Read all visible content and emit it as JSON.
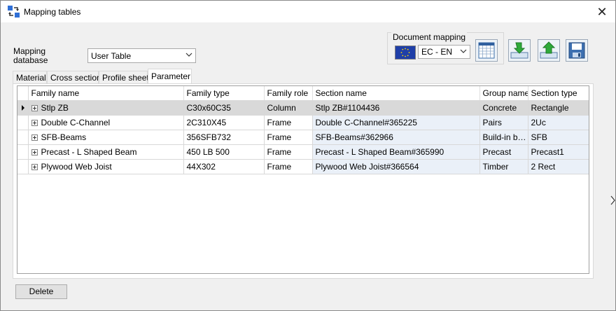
{
  "window": {
    "title": "Mapping tables",
    "close_icon": "close-icon"
  },
  "database": {
    "label": "Mapping database",
    "selected": "User Table"
  },
  "document_mapping": {
    "label": "Document mapping",
    "selected": "EC - EN",
    "flag": "eu-flag-icon"
  },
  "toolbar": [
    {
      "name": "table-icon"
    },
    {
      "name": "import-icon"
    },
    {
      "name": "export-icon"
    },
    {
      "name": "save-icon"
    }
  ],
  "tabs": [
    "Material",
    "Cross section",
    "Profile sheet",
    "Parameter"
  ],
  "active_tab": "Parameter",
  "grid": {
    "columns": [
      "Family name",
      "Family type",
      "Family role",
      "Section name",
      "Group name",
      "Section type"
    ],
    "rows": [
      [
        "Stlp ZB",
        "C30x60C35",
        "Column",
        "Stlp ZB#1104436",
        "Concrete",
        "Rectangle"
      ],
      [
        "Double C-Channel",
        "2C310X45",
        "Frame",
        "Double C-Channel#365225",
        "Pairs",
        "2Uc"
      ],
      [
        "SFB-Beams",
        "356SFB732",
        "Frame",
        "SFB-Beams#362966",
        "Build-in be...",
        "SFB"
      ],
      [
        "Precast - L Shaped Beam",
        "450 LB 500",
        "Frame",
        "Precast - L Shaped Beam#365990",
        "Precast",
        "Precast1"
      ],
      [
        "Plywood Web Joist",
        "44X302",
        "Frame",
        "Plywood Web Joist#366564",
        "Timber",
        "2 Rect"
      ]
    ],
    "selected_row": 0
  },
  "footer": {
    "delete_label": "Delete"
  },
  "colors": {
    "selected_row": "#d9d9d9",
    "section_cell_bg": "#eaf0f8",
    "window_bg": "#f0f0f0"
  }
}
